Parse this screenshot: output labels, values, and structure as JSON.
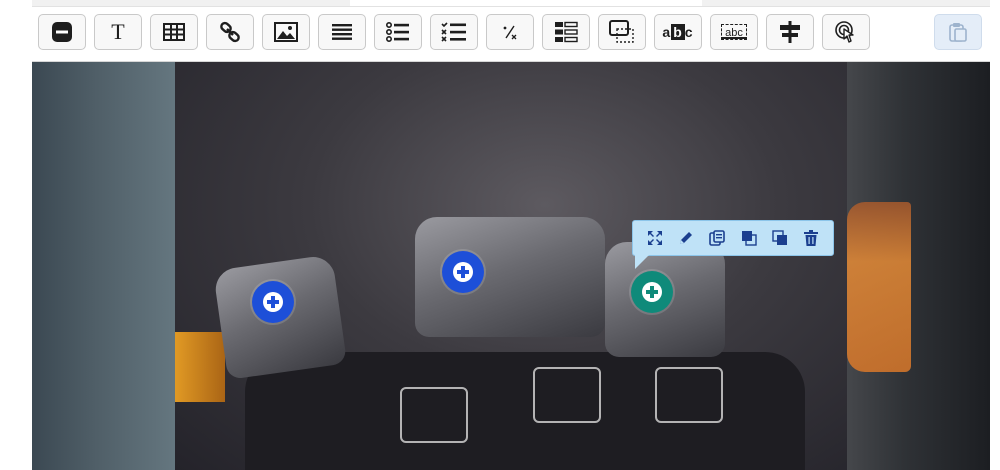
{
  "window": {
    "title": "",
    "accent_color": "#1d4fd8",
    "hotspot_selected_color": "#0f8a7a",
    "popover_color": "#bfe2f7"
  },
  "toolbar": {
    "tools": [
      {
        "name": "separator-tool",
        "icon": "minus-box-icon"
      },
      {
        "name": "text-tool",
        "icon": "text-icon",
        "glyph": "T"
      },
      {
        "name": "table-tool",
        "icon": "table-icon"
      },
      {
        "name": "link-tool",
        "icon": "link-icon"
      },
      {
        "name": "image-tool",
        "icon": "image-icon"
      },
      {
        "name": "list-tool",
        "icon": "list-icon"
      },
      {
        "name": "bullet-list-tool",
        "icon": "bullet-list-icon"
      },
      {
        "name": "checklist-tool",
        "icon": "checklist-icon"
      },
      {
        "name": "fraction-tool",
        "icon": "fraction-icon",
        "glyph": "⁄"
      },
      {
        "name": "form-tool",
        "icon": "form-fields-icon"
      },
      {
        "name": "tooltip-tool",
        "icon": "tooltip-box-icon"
      },
      {
        "name": "fill-blank-tool",
        "icon": "fill-blank-icon",
        "glyph": "abc"
      },
      {
        "name": "text-entry-tool",
        "icon": "text-entry-icon",
        "glyph": "abc"
      },
      {
        "name": "signpost-tool",
        "icon": "signpost-icon"
      },
      {
        "name": "hotspot-tool",
        "icon": "touch-icon"
      }
    ],
    "paste": {
      "name": "paste-button",
      "icon": "clipboard-icon"
    }
  },
  "canvas": {
    "hotspots": [
      {
        "name": "hotspot-left-lever",
        "color": "#1d4fd8",
        "selected": false
      },
      {
        "name": "hotspot-middle-lever",
        "color": "#1d4fd8",
        "selected": false
      },
      {
        "name": "hotspot-right-lever",
        "color": "#0f8a7a",
        "selected": true
      }
    ],
    "popover": {
      "actions": [
        {
          "name": "fullscreen-button",
          "icon": "expand-icon"
        },
        {
          "name": "edit-button",
          "icon": "pencil-icon"
        },
        {
          "name": "duplicate-button",
          "icon": "copy-icon"
        },
        {
          "name": "bring-front-button",
          "icon": "bring-front-icon"
        },
        {
          "name": "send-back-button",
          "icon": "send-back-icon"
        },
        {
          "name": "delete-button",
          "icon": "trash-icon"
        }
      ]
    }
  }
}
